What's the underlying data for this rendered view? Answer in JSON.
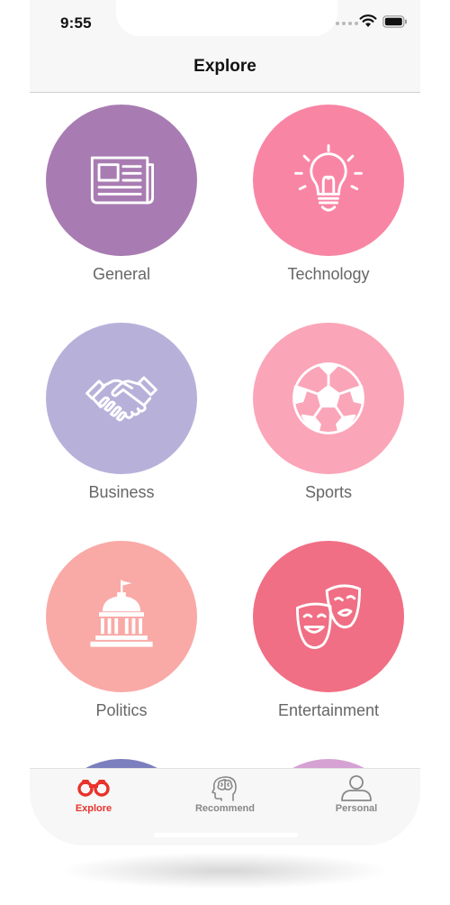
{
  "status": {
    "time": "9:55"
  },
  "nav": {
    "title": "Explore"
  },
  "categories": [
    {
      "label": "General",
      "color": "#a87cb2",
      "icon": "newspaper-icon"
    },
    {
      "label": "Technology",
      "color": "#f985a5",
      "icon": "lightbulb-icon"
    },
    {
      "label": "Business",
      "color": "#b7b1da",
      "icon": "handshake-icon"
    },
    {
      "label": "Sports",
      "color": "#fba5b8",
      "icon": "soccer-ball-icon"
    },
    {
      "label": "Politics",
      "color": "#f9aaa6",
      "icon": "capitol-icon"
    },
    {
      "label": "Entertainment",
      "color": "#f06f84",
      "icon": "theater-masks-icon"
    },
    {
      "label": "",
      "color": "#7b7fbd",
      "icon": ""
    },
    {
      "label": "",
      "color": "#d5a2d3",
      "icon": ""
    }
  ],
  "tabs": [
    {
      "label": "Explore",
      "icon": "binoculars-icon",
      "active": true
    },
    {
      "label": "Recommend",
      "icon": "brain-head-icon",
      "active": false
    },
    {
      "label": "Personal",
      "icon": "person-icon",
      "active": false
    }
  ],
  "colors": {
    "accent": "#e8322b",
    "inactive": "#888888"
  }
}
